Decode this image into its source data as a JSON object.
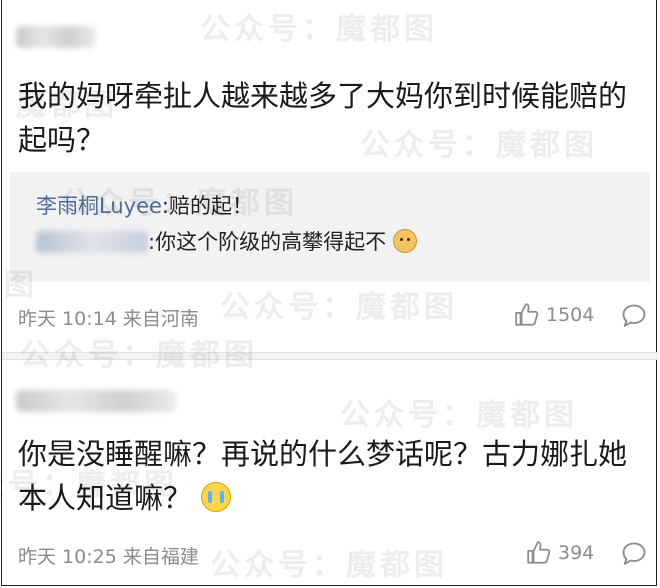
{
  "comments": [
    {
      "text": "我的妈呀牵扯人越来越多了大妈你到时候能赔的起吗？",
      "replies": [
        {
          "name": "李雨桐Luyee",
          "text": ":赔的起！"
        },
        {
          "text": ":你这个阶级的高攀得起不"
        }
      ],
      "time": "昨天 10:14 来自河南",
      "likes": "1504"
    },
    {
      "text": "你是没睡醒嘛？再说的什么梦话呢？古力娜扎她本人知道嘛？",
      "time": "昨天 10:25 来自福建",
      "likes": "394"
    }
  ],
  "watermark": "公众号：魔都图",
  "icons": {
    "like": "thumbs-up-icon",
    "reply": "comment-bubble-icon",
    "doge": "doge-emoji-icon",
    "cry": "crying-emoji-icon"
  }
}
